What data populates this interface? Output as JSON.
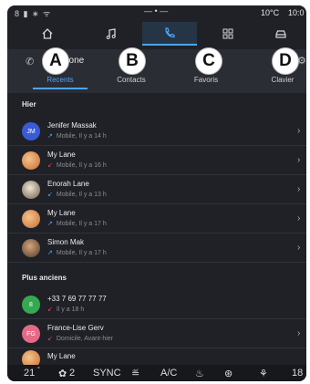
{
  "status": {
    "left_icons": "8 ▮ ∗ ᯤ",
    "center": "— • —",
    "temp": "10°C",
    "clock": "10:0"
  },
  "appbar": {
    "icons": [
      "home-icon",
      "music-icon",
      "phone-icon",
      "apps-icon",
      "car-icon"
    ],
    "active": "phone-icon"
  },
  "phone": {
    "icon": "✆",
    "name": "hone",
    "settings_icon": "⚙"
  },
  "tabs": [
    {
      "label": "Recents",
      "active": true
    },
    {
      "label": "Contacts",
      "active": false
    },
    {
      "label": "Favoris",
      "active": false
    },
    {
      "label": "Clavier",
      "active": false
    }
  ],
  "markers": [
    "A",
    "B",
    "C",
    "D"
  ],
  "sections": {
    "today": "Hier",
    "older": "Plus anciens"
  },
  "calls": [
    {
      "name": "Jenifer Massak",
      "detail": "Mobile, Il y a 14 h",
      "avatar_text": "JM",
      "avatar_color": "#3b5bd6",
      "type": "outgoing"
    },
    {
      "name": "My Lane",
      "detail": "Mobile, Il y a 16 h",
      "avatar_text": "",
      "avatar_color": "#e9a15a",
      "type": "missed"
    },
    {
      "name": "Enorah Lane",
      "detail": "Mobile, Il y a 13 h",
      "avatar_text": "",
      "avatar_color": "#d8c7b0",
      "type": "incoming"
    },
    {
      "name": "My Lane",
      "detail": "Mobile, Il y a 17 h",
      "avatar_text": "",
      "avatar_color": "#e9a15a",
      "type": "outgoing"
    },
    {
      "name": "Simon Mak",
      "detail": "Mobile, Il y a 17 h",
      "avatar_text": "",
      "avatar_color": "#8a6a4e",
      "type": "outgoing"
    },
    {
      "name": "+33 7 69 77 77 77",
      "detail": "Il y a 18 h",
      "avatar_text": "8",
      "avatar_color": "#35a852",
      "type": "missed"
    },
    {
      "name": "France-Lise Gerv",
      "detail": "Domicile, Avant-hier",
      "avatar_text": "FG",
      "avatar_color": "#e46a86",
      "type": "missed"
    },
    {
      "name": "My Lane",
      "detail": "",
      "avatar_text": "",
      "avatar_color": "#e9a15a",
      "type": "outgoing"
    }
  ],
  "climate": {
    "left_temp": "21",
    "fan": "2",
    "sync": "SYNC",
    "ac": "A/C",
    "right_temp": "18"
  },
  "colors": {
    "accent": "#4da3ff",
    "missed": "#d94b4b",
    "background": "#1f2126"
  }
}
